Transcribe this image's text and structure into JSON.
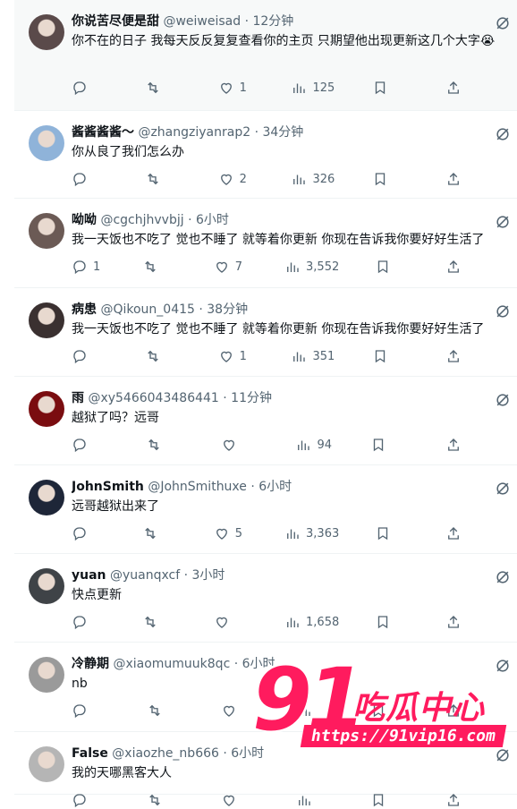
{
  "tweets": [
    {
      "name": "你说苦尽便是甜",
      "handle": "@weiweisad",
      "time": "· 12分钟",
      "text": "你不在的日子 我每天反反复复查看你的主页 只期望他出现更新这几个大字😭",
      "reply": "",
      "retweet": "",
      "like": "1",
      "views": "125",
      "avatar_color": "#5a4a4a"
    },
    {
      "name": "酱酱酱酱〜",
      "handle": "@zhangziyanrap2",
      "time": "· 34分钟",
      "text": "你从良了我们怎么办",
      "reply": "",
      "retweet": "",
      "like": "2",
      "views": "326",
      "avatar_color": "#8fb3d9"
    },
    {
      "name": "呦呦",
      "handle": "@cgchjhvvbjj",
      "time": "· 6小时",
      "text": "我一天饭也不吃了 觉也不睡了 就等着你更新 你现在告诉我你要好好生活了",
      "reply": "1",
      "retweet": "",
      "like": "7",
      "views": "3,552",
      "avatar_color": "#6b5a55"
    },
    {
      "name": "病患",
      "handle": "@Qikoun_0415",
      "time": "· 38分钟",
      "text": "我一天饭也不吃了 觉也不睡了 就等着你更新 你现在告诉我你要好好生活了",
      "reply": "",
      "retweet": "",
      "like": "1",
      "views": "351",
      "avatar_color": "#3a3030"
    },
    {
      "name": "雨",
      "handle": "@xy5466043486441",
      "time": "· 11分钟",
      "text": "越狱了吗？远哥",
      "reply": "",
      "retweet": "",
      "like": "",
      "views": "94",
      "avatar_color": "#7a0d10"
    },
    {
      "name": "JohnSmith",
      "handle": "@JohnSmithuxe",
      "time": "· 6小时",
      "text": "远哥越狱出来了",
      "reply": "",
      "retweet": "",
      "like": "5",
      "views": "3,363",
      "avatar_color": "#1e2638"
    },
    {
      "name": "yuan",
      "handle": "@yuanqxcf",
      "time": "· 3小时",
      "text": "快点更新",
      "reply": "",
      "retweet": "",
      "like": "",
      "views": "1,658",
      "avatar_color": "#3f4347"
    },
    {
      "name": "冷静期",
      "handle": "@xiaomumuuk8qc",
      "time": "· 6小时",
      "text": "nb",
      "reply": "",
      "retweet": "",
      "like": "",
      "views": "",
      "avatar_color": "#9a9a9a"
    },
    {
      "name": "False",
      "handle": "@xiaozhe_nb666",
      "time": "· 6小时",
      "text": "我的天哪黑客大人",
      "reply": "",
      "retweet": "",
      "like": "",
      "views": "",
      "avatar_color": "#b5b5b5"
    }
  ],
  "watermark": {
    "number": "91",
    "brand": "吃瓜中心",
    "url": "https://91vip16.com"
  },
  "colors": {
    "muted": "#536471",
    "accent": "#ff1b5e",
    "divider": "#eff3f4"
  }
}
